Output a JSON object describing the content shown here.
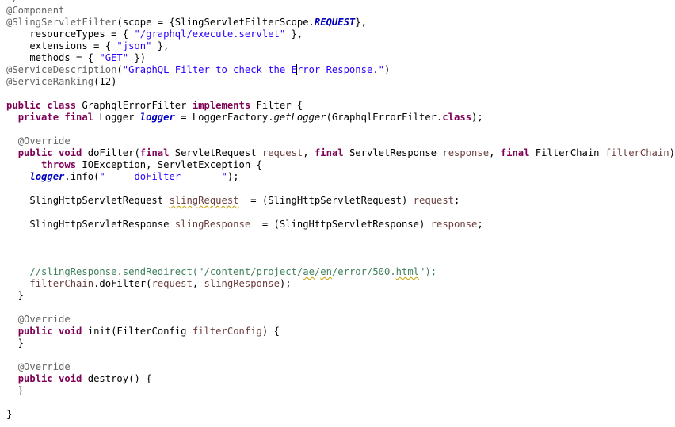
{
  "editor": {
    "lines": [
      {
        "t": [
          {
            "c": "ann",
            "v": "*/"
          }
        ]
      },
      {
        "t": [
          {
            "c": "ann",
            "v": "@Component"
          }
        ]
      },
      {
        "t": [
          {
            "c": "ann",
            "v": "@SlingServletFilter"
          },
          {
            "c": "",
            "v": "(scope = {SlingServletFilterScope."
          },
          {
            "c": "field",
            "v": "REQUEST"
          },
          {
            "c": "",
            "v": "},"
          }
        ]
      },
      {
        "t": [
          {
            "c": "",
            "v": "    resourceTypes = { "
          },
          {
            "c": "str",
            "v": "\"/graphql/execute.servlet\""
          },
          {
            "c": "",
            "v": " },"
          }
        ]
      },
      {
        "t": [
          {
            "c": "",
            "v": "    extensions = { "
          },
          {
            "c": "str",
            "v": "\"json\""
          },
          {
            "c": "",
            "v": " },"
          }
        ]
      },
      {
        "t": [
          {
            "c": "",
            "v": "    methods = { "
          },
          {
            "c": "str",
            "v": "\"GET\""
          },
          {
            "c": "",
            "v": " })"
          }
        ]
      },
      {
        "t": [
          {
            "c": "ann",
            "v": "@ServiceDescription"
          },
          {
            "c": "",
            "v": "("
          },
          {
            "c": "str",
            "v": "\"GraphQL Filter to check the E"
          },
          {
            "c": "str caret",
            "v": "r"
          },
          {
            "c": "str",
            "v": "ror Response.\""
          },
          {
            "c": "",
            "v": ")"
          }
        ]
      },
      {
        "t": [
          {
            "c": "ann",
            "v": "@ServiceRanking"
          },
          {
            "c": "",
            "v": "(12)"
          }
        ]
      },
      {
        "t": []
      },
      {
        "t": [
          {
            "c": "kw",
            "v": "public class"
          },
          {
            "c": "",
            "v": " GraphqlErrorFilter "
          },
          {
            "c": "kw",
            "v": "implements"
          },
          {
            "c": "",
            "v": " Filter {"
          }
        ]
      },
      {
        "t": [
          {
            "c": "",
            "v": "  "
          },
          {
            "c": "kw",
            "v": "private final"
          },
          {
            "c": "",
            "v": " Logger "
          },
          {
            "c": "field",
            "v": "logger"
          },
          {
            "c": "",
            "v": " = LoggerFactory."
          },
          {
            "c": "ital",
            "v": "getLogger"
          },
          {
            "c": "",
            "v": "(GraphqlErrorFilter."
          },
          {
            "c": "kw",
            "v": "class"
          },
          {
            "c": "",
            "v": ");"
          }
        ]
      },
      {
        "t": []
      },
      {
        "t": [
          {
            "c": "",
            "v": "  "
          },
          {
            "c": "ann",
            "v": "@Override"
          }
        ]
      },
      {
        "t": [
          {
            "c": "",
            "v": "  "
          },
          {
            "c": "kw",
            "v": "public void"
          },
          {
            "c": "",
            "v": " doFilter("
          },
          {
            "c": "kw",
            "v": "final"
          },
          {
            "c": "",
            "v": " ServletRequest "
          },
          {
            "c": "param",
            "v": "request"
          },
          {
            "c": "",
            "v": ", "
          },
          {
            "c": "kw",
            "v": "final"
          },
          {
            "c": "",
            "v": " ServletResponse "
          },
          {
            "c": "param",
            "v": "response"
          },
          {
            "c": "",
            "v": ", "
          },
          {
            "c": "kw",
            "v": "final"
          },
          {
            "c": "",
            "v": " FilterChain "
          },
          {
            "c": "param",
            "v": "filterChain"
          },
          {
            "c": "",
            "v": ")"
          }
        ]
      },
      {
        "t": [
          {
            "c": "",
            "v": "      "
          },
          {
            "c": "kw",
            "v": "throws"
          },
          {
            "c": "",
            "v": " IOException, ServletException {"
          }
        ]
      },
      {
        "t": [
          {
            "c": "",
            "v": "    "
          },
          {
            "c": "field",
            "v": "logger"
          },
          {
            "c": "",
            "v": ".info("
          },
          {
            "c": "str",
            "v": "\"-----doFilter-------\""
          },
          {
            "c": "",
            "v": ");"
          }
        ]
      },
      {
        "t": []
      },
      {
        "t": [
          {
            "c": "",
            "v": "    SlingHttpServletRequest "
          },
          {
            "c": "param warn",
            "v": "slingRequest"
          },
          {
            "c": "",
            "v": "  = (SlingHttpServletRequest) "
          },
          {
            "c": "param",
            "v": "request"
          },
          {
            "c": "",
            "v": ";"
          }
        ]
      },
      {
        "t": []
      },
      {
        "t": [
          {
            "c": "",
            "v": "    SlingHttpServletResponse "
          },
          {
            "c": "param",
            "v": "slingResponse"
          },
          {
            "c": "",
            "v": "  = (SlingHttpServletResponse) "
          },
          {
            "c": "param",
            "v": "response"
          },
          {
            "c": "",
            "v": ";"
          }
        ]
      },
      {
        "t": []
      },
      {
        "t": []
      },
      {
        "t": []
      },
      {
        "t": [
          {
            "c": "",
            "v": "    "
          },
          {
            "c": "cmt",
            "v": "//slingResponse.sendRedirect(\"/content/project/"
          },
          {
            "c": "cmt warn",
            "v": "ae"
          },
          {
            "c": "cmt",
            "v": "/"
          },
          {
            "c": "cmt warn",
            "v": "en"
          },
          {
            "c": "cmt",
            "v": "/error/500."
          },
          {
            "c": "cmt warn",
            "v": "html"
          },
          {
            "c": "cmt",
            "v": "\");"
          }
        ]
      },
      {
        "t": [
          {
            "c": "",
            "v": "    "
          },
          {
            "c": "param",
            "v": "filterChain"
          },
          {
            "c": "",
            "v": ".doFilter("
          },
          {
            "c": "param",
            "v": "request"
          },
          {
            "c": "",
            "v": ", "
          },
          {
            "c": "param",
            "v": "slingResponse"
          },
          {
            "c": "",
            "v": ");"
          }
        ]
      },
      {
        "t": [
          {
            "c": "",
            "v": "  }"
          }
        ]
      },
      {
        "t": []
      },
      {
        "t": [
          {
            "c": "",
            "v": "  "
          },
          {
            "c": "ann",
            "v": "@Override"
          }
        ]
      },
      {
        "t": [
          {
            "c": "",
            "v": "  "
          },
          {
            "c": "kw",
            "v": "public void"
          },
          {
            "c": "",
            "v": " init(FilterConfig "
          },
          {
            "c": "param",
            "v": "filterConfig"
          },
          {
            "c": "",
            "v": ") {"
          }
        ]
      },
      {
        "t": [
          {
            "c": "",
            "v": "  }"
          }
        ]
      },
      {
        "t": []
      },
      {
        "t": [
          {
            "c": "",
            "v": "  "
          },
          {
            "c": "ann",
            "v": "@Override"
          }
        ]
      },
      {
        "t": [
          {
            "c": "",
            "v": "  "
          },
          {
            "c": "kw",
            "v": "public void"
          },
          {
            "c": "",
            "v": " destroy() {"
          }
        ]
      },
      {
        "t": [
          {
            "c": "",
            "v": "  }"
          }
        ]
      },
      {
        "t": []
      },
      {
        "t": [
          {
            "c": "",
            "v": "}"
          }
        ]
      }
    ]
  }
}
